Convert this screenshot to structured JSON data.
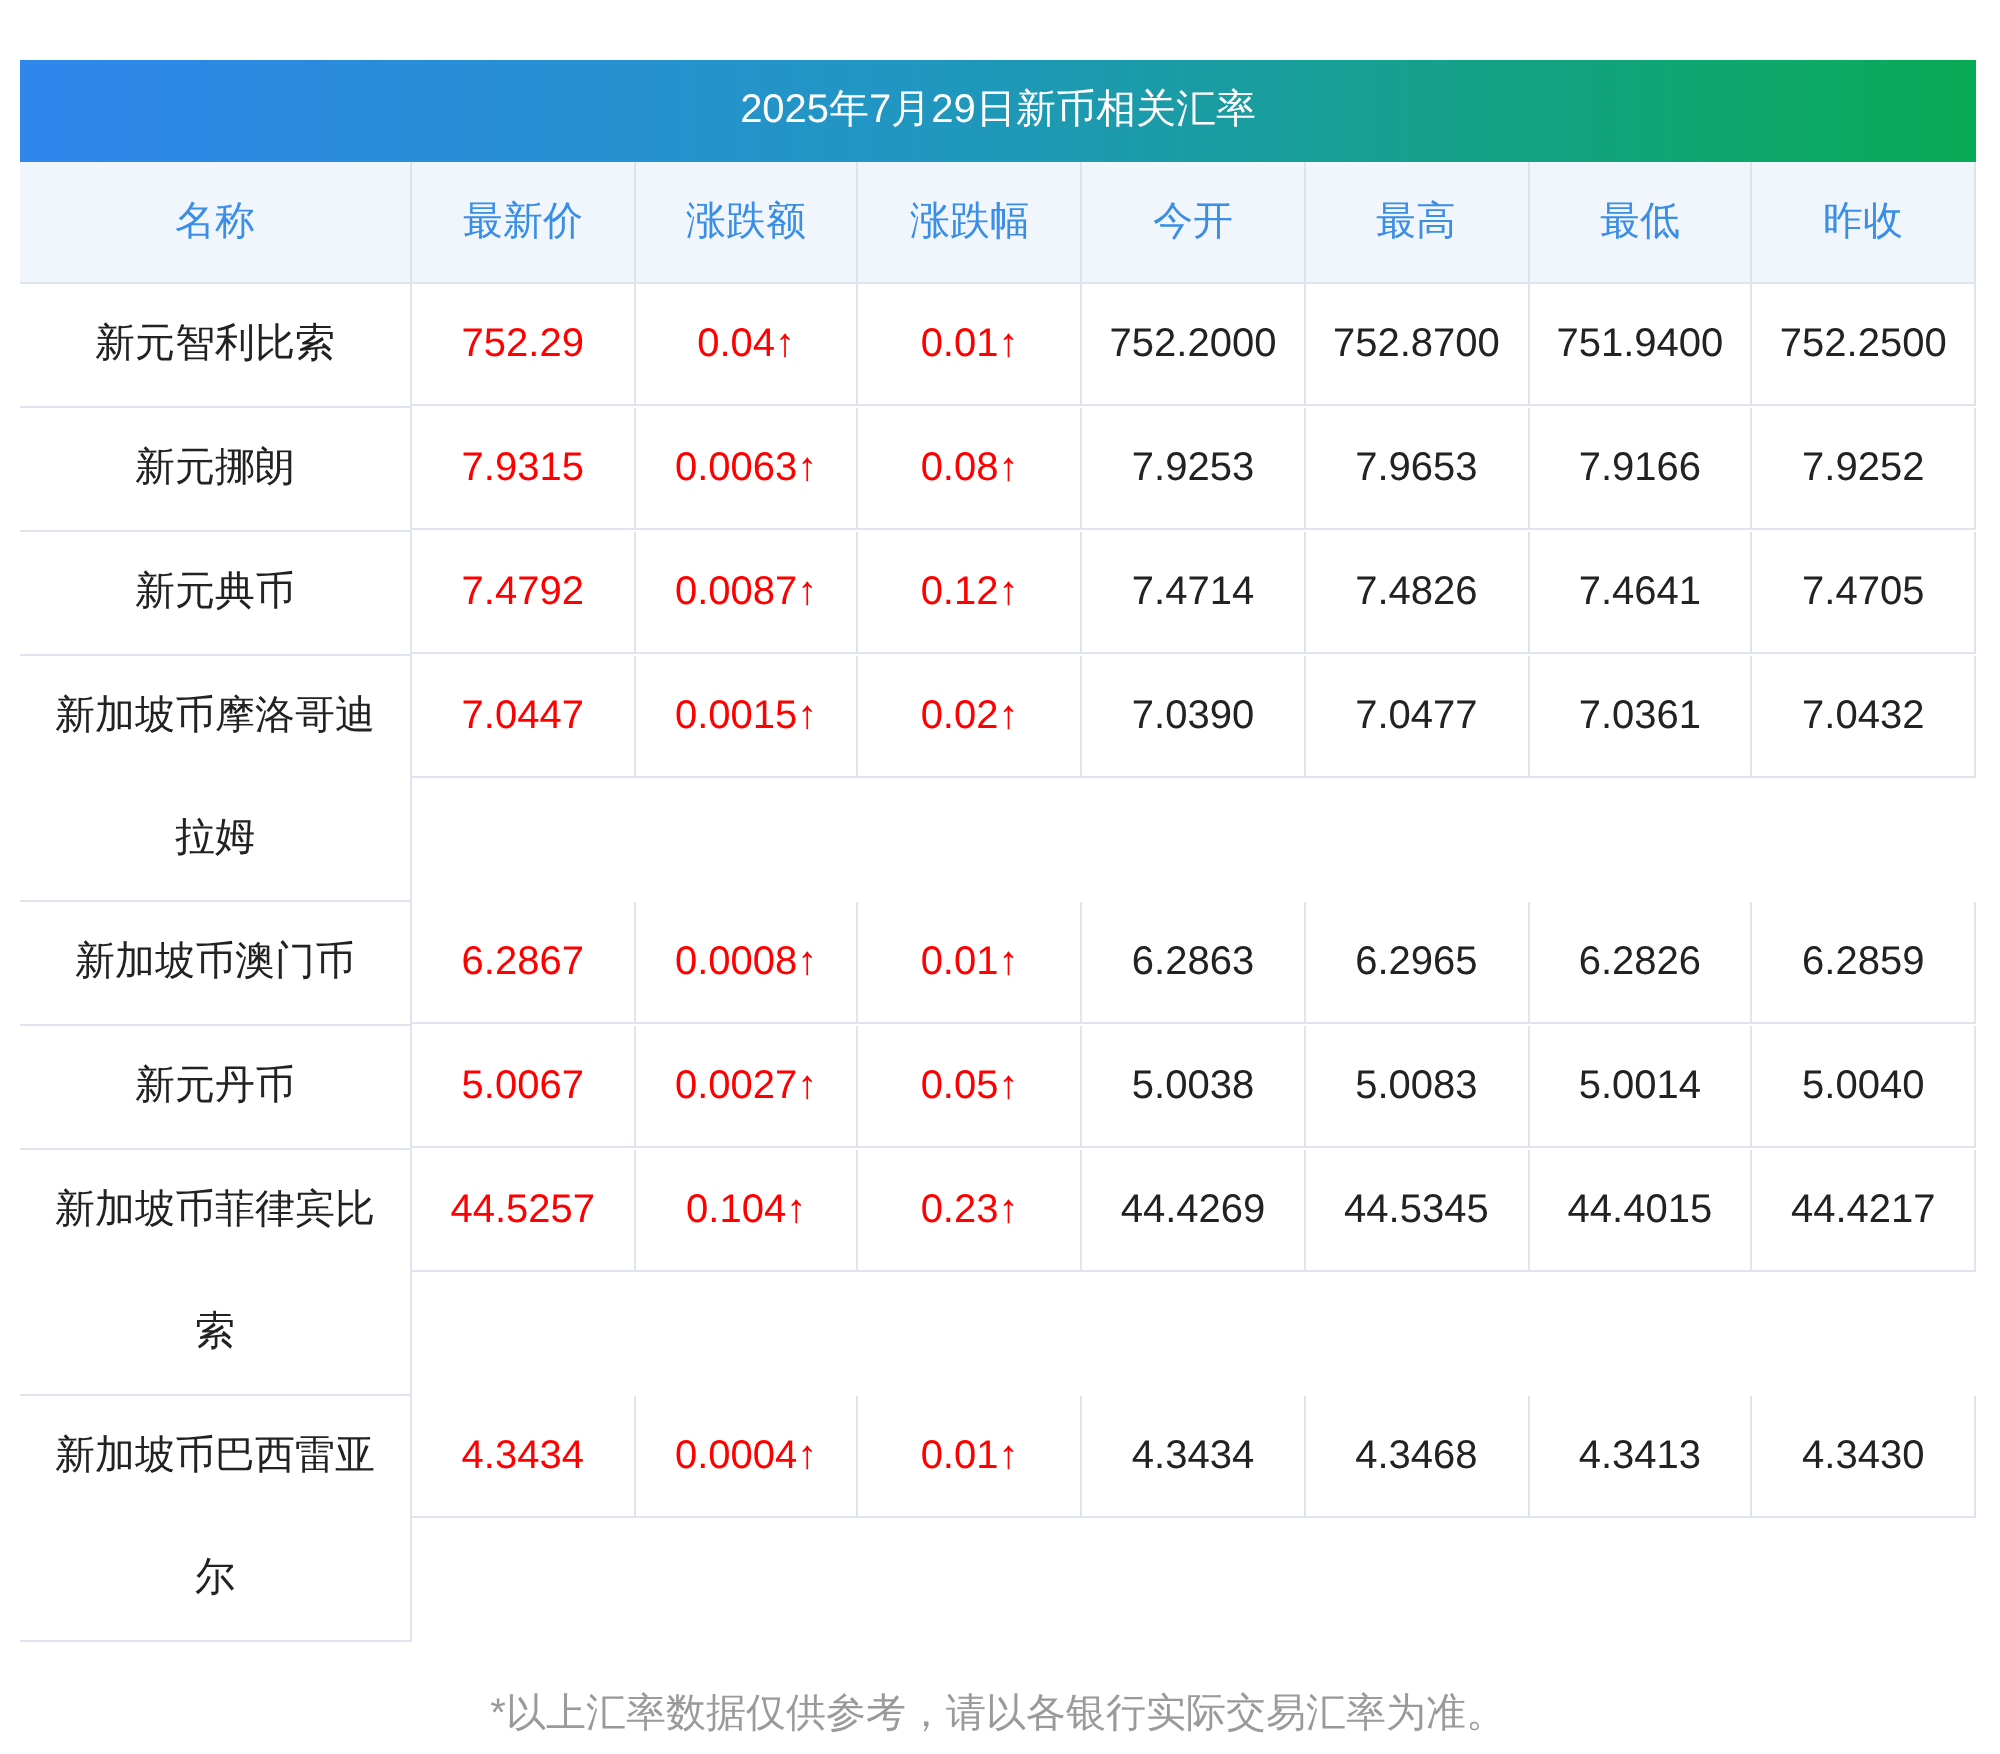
{
  "title": "2025年7月29日新币相关汇率",
  "columns": [
    "名称",
    "最新价",
    "涨跌额",
    "涨跌幅",
    "今开",
    "最高",
    "最低",
    "昨收"
  ],
  "rows": [
    {
      "name": "新元智利比索",
      "rising": true,
      "values": [
        "752.29",
        "0.04↑",
        "0.01↑",
        "752.2000",
        "752.8700",
        "751.9400",
        "752.2500"
      ]
    },
    {
      "name": "新元挪朗",
      "rising": true,
      "values": [
        "7.9315",
        "0.0063↑",
        "0.08↑",
        "7.9253",
        "7.9653",
        "7.9166",
        "7.9252"
      ]
    },
    {
      "name": "新元典币",
      "rising": true,
      "values": [
        "7.4792",
        "0.0087↑",
        "0.12↑",
        "7.4714",
        "7.4826",
        "7.4641",
        "7.4705"
      ]
    },
    {
      "name": "新加坡币摩洛哥迪拉姆",
      "rising": true,
      "values": [
        "7.0447",
        "0.0015↑",
        "0.02↑",
        "7.0390",
        "7.0477",
        "7.0361",
        "7.0432"
      ]
    },
    {
      "name": "新加坡币澳门币",
      "rising": true,
      "values": [
        "6.2867",
        "0.0008↑",
        "0.01↑",
        "6.2863",
        "6.2965",
        "6.2826",
        "6.2859"
      ]
    },
    {
      "name": "新元丹币",
      "rising": true,
      "values": [
        "5.0067",
        "0.0027↑",
        "0.05↑",
        "5.0038",
        "5.0083",
        "5.0014",
        "5.0040"
      ]
    },
    {
      "name": "新加坡币菲律宾比索",
      "rising": true,
      "values": [
        "44.5257",
        "0.104↑",
        "0.23↑",
        "44.4269",
        "44.5345",
        "44.4015",
        "44.4217"
      ]
    },
    {
      "name": "新加坡币巴西雷亚尔",
      "rising": true,
      "values": [
        "4.3434",
        "0.0004↑",
        "0.01↑",
        "4.3434",
        "4.3468",
        "4.3413",
        "4.3430"
      ]
    }
  ],
  "footnote": "*以上汇率数据仅供参考，请以各银行实际交易汇率为准。"
}
